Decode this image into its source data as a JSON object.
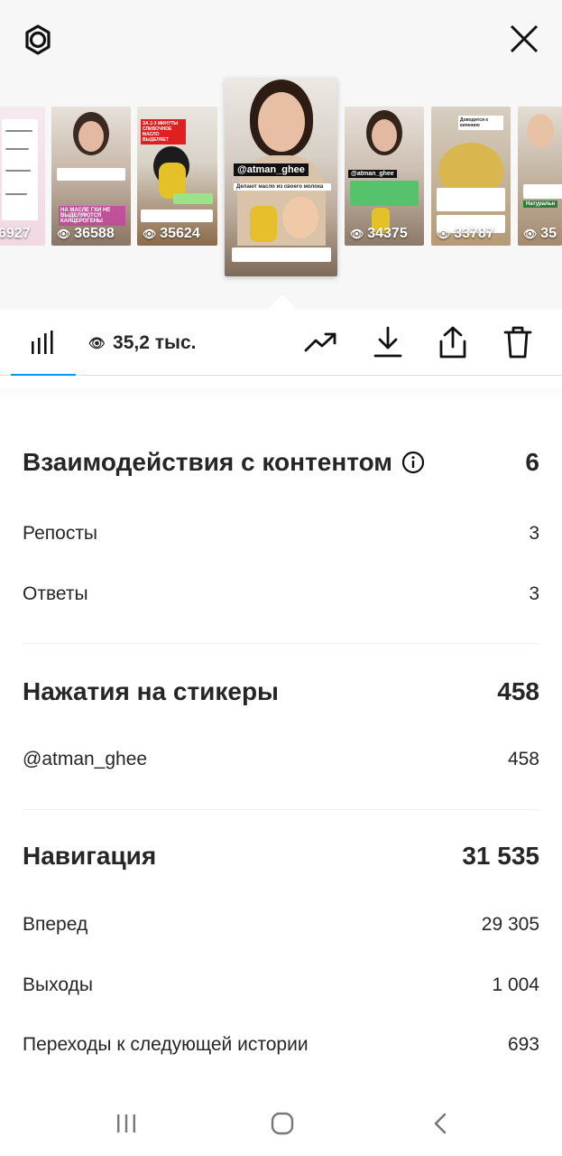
{
  "icons": {
    "settings": "settings-gear-icon",
    "close": "close-icon",
    "insights": "bar-chart-icon",
    "eye": "eye-icon",
    "trend": "trending-up-icon",
    "download": "download-icon",
    "share": "share-icon",
    "delete": "trash-icon"
  },
  "carousel": {
    "stories": [
      {
        "views": "6927"
      },
      {
        "views": "36588",
        "overlay_text": "НА МАСЛЕ ГХИ НЕ ВЫДЕЛЯЮТСЯ КАНЦЕРОГЕНЫ"
      },
      {
        "views": "35624",
        "overlay_text": "ЗА 2-3 МИНУТЫ СЛИВОЧНОЕ МАСЛО ВЫДЕЛЯЕТ"
      },
      {
        "mention": "@atman_ghee",
        "caption": "Делают масло из своего молока",
        "selected": true
      },
      {
        "views": "34375",
        "mention": "@atman_ghee"
      },
      {
        "views": "33787",
        "overlay_text": "Доводится к кипению"
      },
      {
        "views": "35",
        "overlay_text": "Натуральн"
      }
    ]
  },
  "toolbar": {
    "views_label": "35,2 тыс."
  },
  "sections": {
    "interactions": {
      "title": "Взаимодействия с контентом",
      "value": "6",
      "rows": [
        {
          "label": "Репосты",
          "value": "3"
        },
        {
          "label": "Ответы",
          "value": "3"
        }
      ]
    },
    "stickers": {
      "title": "Нажатия на стикеры",
      "value": "458",
      "rows": [
        {
          "label": "@atman_ghee",
          "value": "458"
        }
      ]
    },
    "navigation": {
      "title": "Навигация",
      "value": "31 535",
      "rows": [
        {
          "label": "Вперед",
          "value": "29 305"
        },
        {
          "label": "Выходы",
          "value": "1 004"
        },
        {
          "label": "Переходы к следующей истории",
          "value": "693"
        }
      ]
    }
  },
  "colors": {
    "accent": "#0095f6",
    "text": "#262626",
    "tab_bg": "#f7f7f7"
  }
}
